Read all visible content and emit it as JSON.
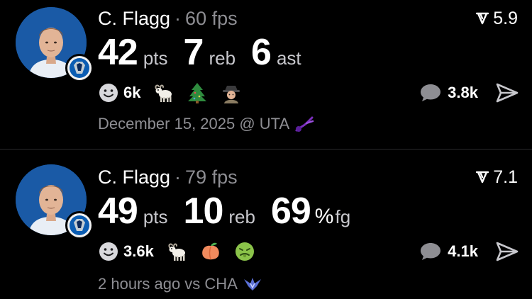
{
  "posts": [
    {
      "player": "C. Flagg",
      "separator": "·",
      "fps": "60 fps",
      "score": "5.9",
      "stats": [
        {
          "value": "42",
          "prefix": "",
          "unit": "pts"
        },
        {
          "value": "7",
          "prefix": "",
          "unit": "reb"
        },
        {
          "value": "6",
          "prefix": "",
          "unit": "ast"
        }
      ],
      "reaction_count": "6k",
      "reaction_emojis": [
        "goat-icon",
        "christmas-tree-icon",
        "detective-icon"
      ],
      "comment_count": "3.8k",
      "footer": "December 15, 2025 @ UTA",
      "opponent_logo": "jazz-note-icon",
      "opponent_color": "#7b2fbe"
    },
    {
      "player": "C. Flagg",
      "separator": "·",
      "fps": "79 fps",
      "score": "7.1",
      "stats": [
        {
          "value": "49",
          "prefix": "",
          "unit": "pts"
        },
        {
          "value": "10",
          "prefix": "",
          "unit": "reb"
        },
        {
          "value": "69",
          "prefix": "%",
          "unit": "fg"
        }
      ],
      "reaction_count": "3.6k",
      "reaction_emojis": [
        "goat-icon",
        "peach-icon",
        "nauseated-face-icon"
      ],
      "comment_count": "4.1k",
      "footer": "2 hours ago vs CHA",
      "opponent_logo": "hornets-icon",
      "opponent_color": "#5a6fd6"
    }
  ],
  "colors": {
    "background": "#000000",
    "primary_text": "#ffffff",
    "secondary_text": "#8e8e93",
    "divider": "#2a2a2c"
  }
}
